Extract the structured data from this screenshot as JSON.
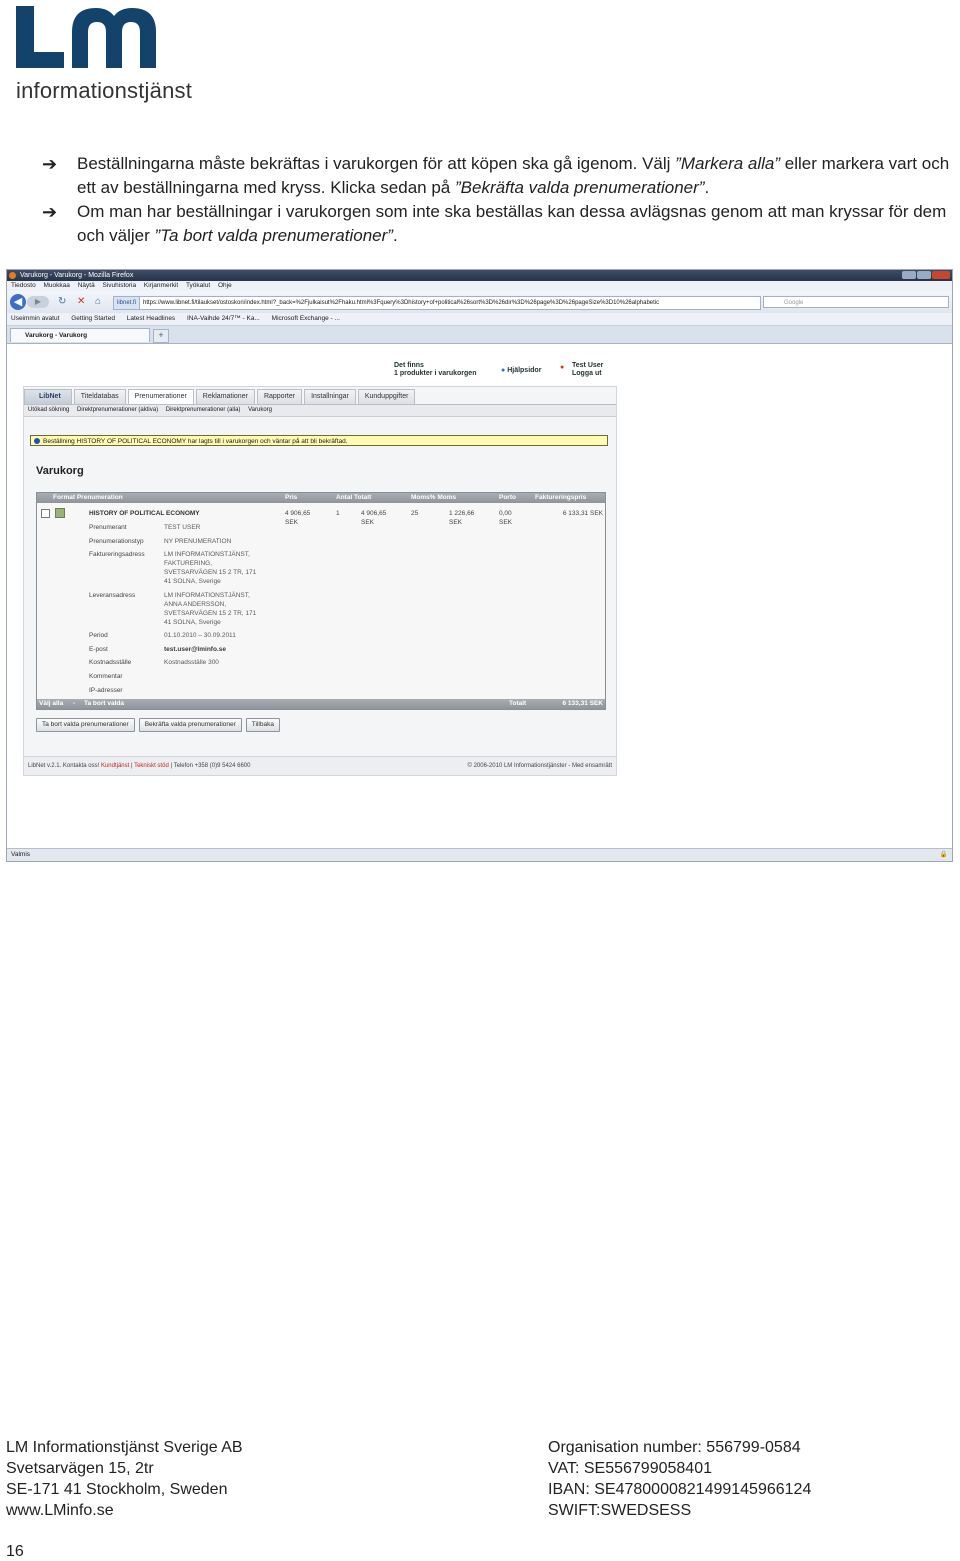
{
  "logo": {
    "letters": "LM",
    "subtitle": "informationstjänst",
    "color": "#13436b"
  },
  "bullets": [
    {
      "icon": "arrow-right-icon",
      "parts": [
        "Beställningarna måste bekräftas i varukorgen för att köpen ska gå igenom. Välj ",
        "”Markera alla”",
        " eller markera vart och ett av beställningarna med kryss. Klicka sedan på ",
        "”Bekräfta valda prenumerationer”",
        "."
      ]
    },
    {
      "icon": "arrow-right-icon",
      "parts": [
        "Om man har beställningar i varukorgen som inte ska beställas kan dessa avlägsnas genom att man kryssar för dem och väljer ",
        "”Ta bort valda prenumerationer”",
        "."
      ]
    }
  ],
  "browser": {
    "window_title": "Varukorg - Varukorg - Mozilla Firefox",
    "menu": [
      "Tiedosto",
      "Muokkaa",
      "Näytä",
      "Sivuhistoria",
      "Kirjanmerkit",
      "Työkalut",
      "Ohje"
    ],
    "site_badge": "libnet.fi",
    "url": "https://www.libnet.fi/tilaukset/ostoskori/index.html?_back=%2Fjulkaisut%2Fhaku.html%3Fquery%3Dhistory+of+political%26sort%3D%26dir%3D%26page%3D%26pageSize%3D10%26alphabetic",
    "search_placeholder": "Google",
    "bookmarks": [
      "Useimmin avatut",
      "Getting Started",
      "Latest Headlines",
      "INA-Vaihde 24/7™ - Ka...",
      "Microsoft Exchange - ..."
    ],
    "tab_title": "Varukorg - Varukorg",
    "status": "Valmis"
  },
  "app": {
    "cart_info_line1": "Det finns",
    "cart_info_line2": "1 produkter i varukorgen",
    "help": "Hjälpsidor",
    "user": "Test User",
    "logout": "Logga ut",
    "logo": "LibNet",
    "tabs": [
      "Titeldatabas",
      "Prenumerationer",
      "Reklamationer",
      "Rapporter",
      "Installningar",
      "Kunduppgifter"
    ],
    "active_tab": "Prenumerationer",
    "subtabs": [
      "Utökad sökning",
      "Direktprenumerationer (aktiva)",
      "Direktprenumerationer (alla)",
      "Varukorg"
    ],
    "alert": "Beställning HISTORY OF POLITICAL ECONOMY har lagts till i varukorgen och väntar på att bli bekräftad.",
    "heading": "Varukorg",
    "columns": [
      "Format Prenumeration",
      "Pris",
      "Antal Totalt",
      "Moms% Moms",
      "Porto",
      "Faktureringspris"
    ],
    "item": {
      "title": "HISTORY OF POLITICAL ECONOMY",
      "price_line1": "4 906,65",
      "price_line2": "SEK",
      "qty": "1",
      "total_line1": "4 906,65",
      "total_line2": "SEK",
      "vat_pct": "25",
      "vat_line1": "1 226,66",
      "vat_line2": "SEK",
      "postage_line1": "0,00",
      "postage_line2": "SEK",
      "invoice_price": "6 133,31 SEK"
    },
    "details": [
      {
        "label": "Prenumerant",
        "lines": [
          "TEST USER"
        ]
      },
      {
        "label": "Prenumerationstyp",
        "lines": [
          "NY PRENUMERATION"
        ]
      },
      {
        "label": "Faktureringsadress",
        "lines": [
          "LM INFORMATIONSTJÄNST,",
          "FAKTURERING,",
          "SVETSARVÄGEN 15 2 TR, 171",
          "41 SOLNA, Sverige"
        ]
      },
      {
        "label": "Leveransadress",
        "lines": [
          "LM INFORMATIONSTJÄNST,",
          "ANNA ANDERSSON,",
          "SVETSARVÄGEN 15 2 TR, 171",
          "41 SOLNA, Sverige"
        ]
      },
      {
        "label": "Period",
        "lines": [
          "01.10.2010 – 30.09.2011"
        ]
      },
      {
        "label": "E-post",
        "lines": [
          "test.user@lminfo.se"
        ]
      },
      {
        "label": "Kostnadsställe",
        "lines": [
          "Kostnadsställe 300"
        ]
      },
      {
        "label": "Kommentar",
        "lines": [
          ""
        ]
      },
      {
        "label": "IP-adresser",
        "lines": [
          ""
        ]
      }
    ],
    "select_all": "Välj alla",
    "sep": "-",
    "remove_selected": "Ta bort valda",
    "total_label": "Totalt",
    "total_value": "6 133,31 SEK",
    "buttons": [
      "Ta bort valda prenumerationer",
      "Bekräfta valda prenumerationer",
      "Tillbaka"
    ],
    "footer_left": "LibNet v.2.1. Kontakta oss!",
    "footer_customer": "Kundtjänst",
    "footer_tech": "Tekniskt stöd",
    "footer_phone": "Telefon +358 (0)9 5424 6600",
    "footer_right": "© 2006-2010 LM Informationstjänster - Med ensamrätt"
  },
  "footer": {
    "left": [
      "LM Informationstjänst Sverige AB",
      "Svetsarvägen 15, 2tr",
      "SE-171 41 Stockholm, Sweden",
      "www.LMinfo.se"
    ],
    "right": [
      "Organisation number: 556799-0584",
      "VAT: SE556799058401",
      "IBAN: SE4780000821499145966124",
      "SWIFT:SWEDSESS"
    ]
  },
  "page_number": "16"
}
